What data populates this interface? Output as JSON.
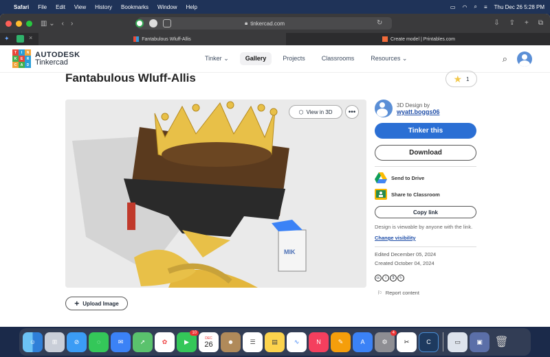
{
  "menubar": {
    "app": "Safari",
    "items": [
      "File",
      "Edit",
      "View",
      "History",
      "Bookmarks",
      "Window",
      "Help"
    ],
    "clock": "Thu Dec 26  5:28 PM"
  },
  "browser": {
    "url": "tinkercad.com",
    "tabs": [
      {
        "label": "Fantabulous Wluff-Allis",
        "active": true
      },
      {
        "label": "Create model | Printables.com",
        "active": false
      }
    ]
  },
  "site": {
    "logo_letters": [
      "T",
      "I",
      "N",
      "K",
      "E",
      "R",
      "C",
      "A",
      "D"
    ],
    "brand_top": "AUTODESK",
    "brand_bottom": "Tinkercad",
    "nav": [
      {
        "label": "Tinker",
        "dropdown": true
      },
      {
        "label": "Gallery",
        "active": true
      },
      {
        "label": "Projects"
      },
      {
        "label": "Classrooms"
      },
      {
        "label": "Resources",
        "dropdown": true
      }
    ]
  },
  "design": {
    "title": "Fantabulous Wluff-Allis",
    "favorites_count": "1",
    "view_3d_label": "View in 3D",
    "more_label": "•••",
    "upload_label": "Upload Image"
  },
  "sidebar": {
    "by_label": "3D Design by",
    "author": "wyatt.boggs06",
    "tinker_label": "Tinker this",
    "download_label": "Download",
    "send_drive": "Send to Drive",
    "share_classroom": "Share to Classroom",
    "copy_link": "Copy link",
    "visibility_note": "Design is viewable by anyone with the link.",
    "change_visibility": "Change visibility",
    "edited": "Edited December 05, 2024",
    "created": "Created October 04, 2024",
    "report": "Report content"
  },
  "dock": {
    "badges": {
      "facetime": "10",
      "settings": "4"
    },
    "calendar_month": "DEC",
    "calendar_day": "26"
  },
  "colors": {
    "primary": "#2b6fd4",
    "crown": "#e8c048",
    "glasses": "#2a2a2a"
  }
}
